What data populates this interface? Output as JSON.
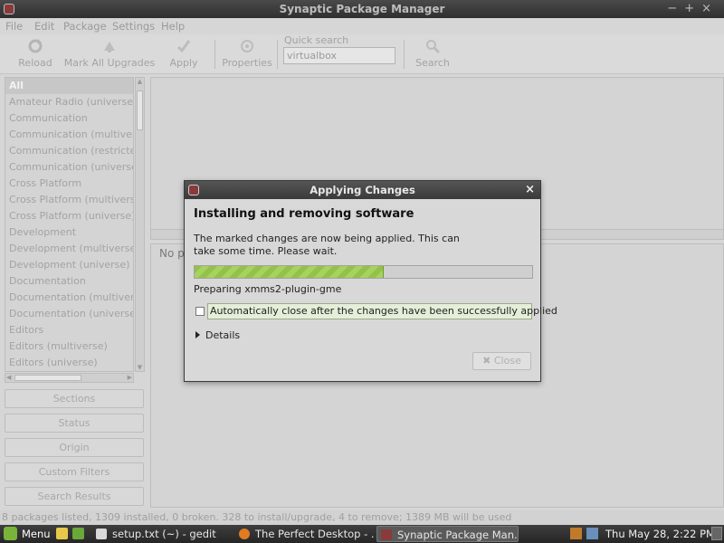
{
  "window": {
    "title": "Synaptic Package Manager"
  },
  "menu": [
    "File",
    "Edit",
    "Package",
    "Settings",
    "Help"
  ],
  "toolbar": {
    "reload": "Reload",
    "mark_all": "Mark All Upgrades",
    "apply": "Apply",
    "properties": "Properties",
    "quick_search_label": "Quick search",
    "quick_search_value": "virtualbox",
    "search": "Search"
  },
  "categories": [
    "All",
    "Amateur Radio (universe)",
    "Communication",
    "Communication (multiverse)",
    "Communication (restricted)",
    "Communication (universe)",
    "Cross Platform",
    "Cross Platform (multiverse)",
    "Cross Platform (universe)",
    "Development",
    "Development (multiverse)",
    "Development (universe)",
    "Documentation",
    "Documentation (multiverse)",
    "Documentation (universe)",
    "Editors",
    "Editors (multiverse)",
    "Editors (universe)"
  ],
  "side_buttons": {
    "sections": "Sections",
    "status": "Status",
    "origin": "Origin",
    "custom_filters": "Custom Filters",
    "search_results": "Search Results"
  },
  "description_text": "No pa",
  "status_bar": "8 packages listed, 1309 installed, 0 broken. 328 to install/upgrade, 4 to remove; 1389 MB will be used",
  "dialog": {
    "title": "Applying Changes",
    "heading": "Installing and removing software",
    "message": "The marked changes are now being applied. This can take some time. Please wait.",
    "progress": 0.56,
    "status": "Preparing xmms2-plugin-gme",
    "auto_close_label": "Automatically close after the changes have been successfully applied",
    "details": "Details",
    "close": "Close"
  },
  "taskbar": {
    "menu": "Menu",
    "tasks": [
      {
        "label": "setup.txt (~) - gedit",
        "active": false
      },
      {
        "label": "The Perfect Desktop - ...",
        "active": false
      },
      {
        "label": "Synaptic Package Man...",
        "active": true
      }
    ],
    "clock": "Thu May 28,  2:22 PM"
  },
  "colors": {
    "progress_fill": "#93c24a",
    "taskbar_bg": "#2f2f2f",
    "titlebar_bg": "#3a3a3a"
  }
}
